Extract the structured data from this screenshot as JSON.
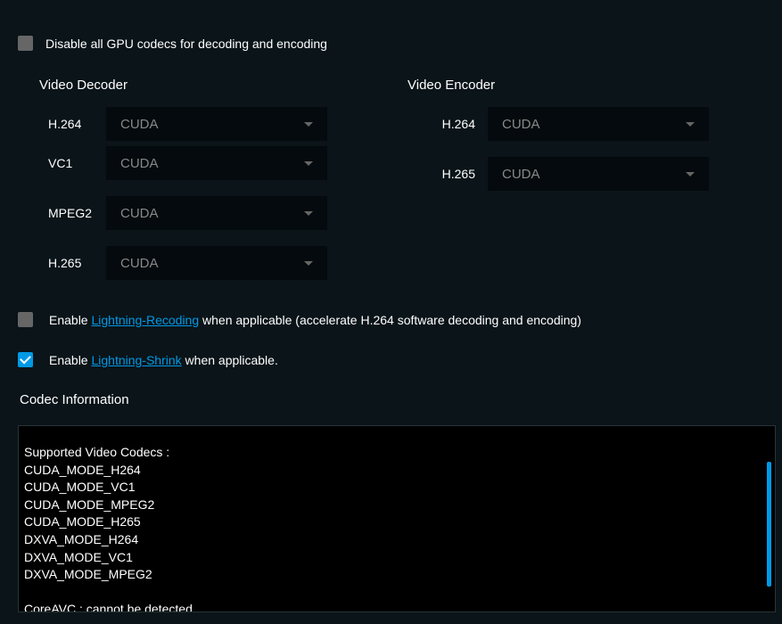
{
  "disableGpuLabel": "Disable all GPU codecs for decoding and encoding",
  "decoder": {
    "heading": "Video Decoder",
    "rows": {
      "h264": {
        "label": "H.264",
        "value": "CUDA"
      },
      "vc1": {
        "label": "VC1",
        "value": "CUDA"
      },
      "mpeg2": {
        "label": "MPEG2",
        "value": "CUDA"
      },
      "h265": {
        "label": "H.265",
        "value": "CUDA"
      }
    }
  },
  "encoder": {
    "heading": "Video Encoder",
    "rows": {
      "h264": {
        "label": "H.264",
        "value": "CUDA"
      },
      "h265": {
        "label": "H.265",
        "value": "CUDA"
      }
    }
  },
  "lightningRecoding": {
    "prefix": "Enable ",
    "link": "Lightning-Recoding",
    "suffix": " when applicable (accelerate H.264 software decoding and encoding)"
  },
  "lightningShrink": {
    "prefix": "Enable ",
    "link": "Lightning-Shrink",
    "suffix": " when applicable."
  },
  "codecInfo": {
    "heading": "Codec Information",
    "text": "Supported Video Codecs :\nCUDA_MODE_H264\nCUDA_MODE_VC1\nCUDA_MODE_MPEG2\nCUDA_MODE_H265\nDXVA_MODE_H264\nDXVA_MODE_VC1\nDXVA_MODE_MPEG2\n\nCoreAVC : cannot be detected."
  }
}
